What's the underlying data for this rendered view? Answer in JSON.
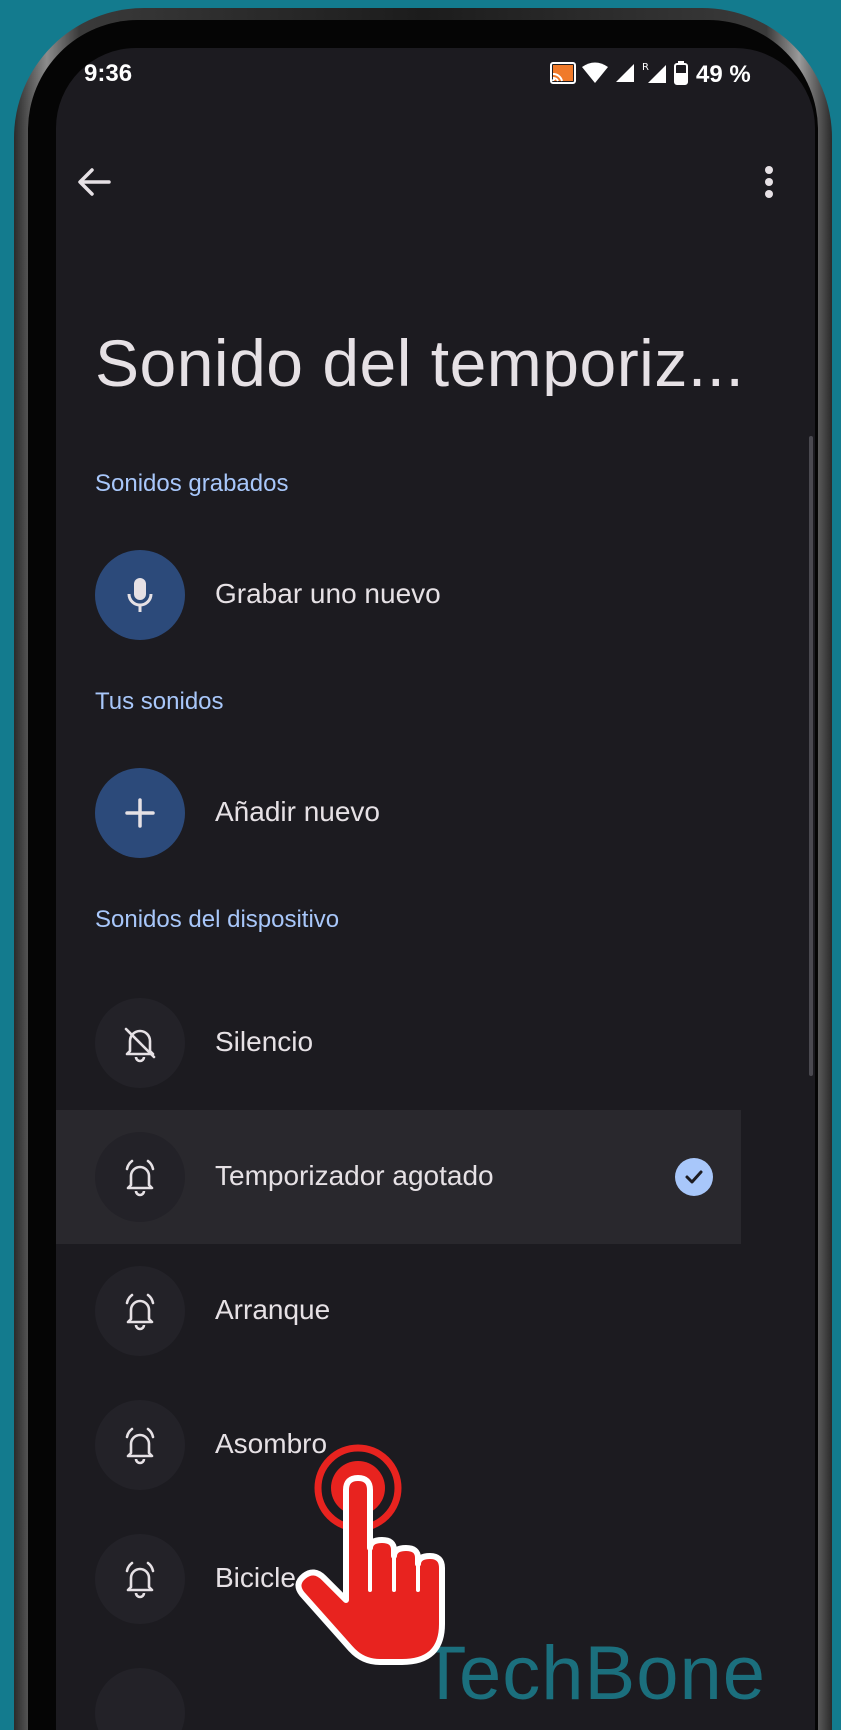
{
  "status_bar": {
    "time": "9:36",
    "battery": "49 %",
    "icons": [
      "cast-icon",
      "wifi-icon",
      "signal-icon",
      "signal-roaming-icon",
      "battery-icon"
    ]
  },
  "app_bar": {
    "back_icon": "arrow-left-icon",
    "more_icon": "more-vert-icon"
  },
  "page": {
    "title": "Sonido del temporiz..."
  },
  "sections": {
    "recorded": {
      "header": "Sonidos grabados",
      "items": [
        {
          "label": "Grabar uno nuevo",
          "icon": "microphone-icon"
        }
      ]
    },
    "yours": {
      "header": "Tus sonidos",
      "items": [
        {
          "label": "Añadir nuevo",
          "icon": "plus-icon"
        }
      ]
    },
    "device": {
      "header": "Sonidos del dispositivo",
      "items": [
        {
          "label": "Silencio",
          "icon": "bell-off-icon",
          "selected": false
        },
        {
          "label": "Temporizador agotado",
          "icon": "alarm-bell-icon",
          "selected": true
        },
        {
          "label": "Arranque",
          "icon": "alarm-bell-icon",
          "selected": false
        },
        {
          "label": "Asombro",
          "icon": "alarm-bell-icon",
          "selected": false
        },
        {
          "label": "Bicicle",
          "icon": "alarm-bell-icon",
          "selected": false
        }
      ]
    }
  },
  "watermark": "TechBone",
  "colors": {
    "background": "#137b8e",
    "screen": "#1c1b20",
    "accent": "#a8c7fa",
    "action_icon_bg": "#2c4a7a",
    "tap_indicator": "#e8231f"
  }
}
